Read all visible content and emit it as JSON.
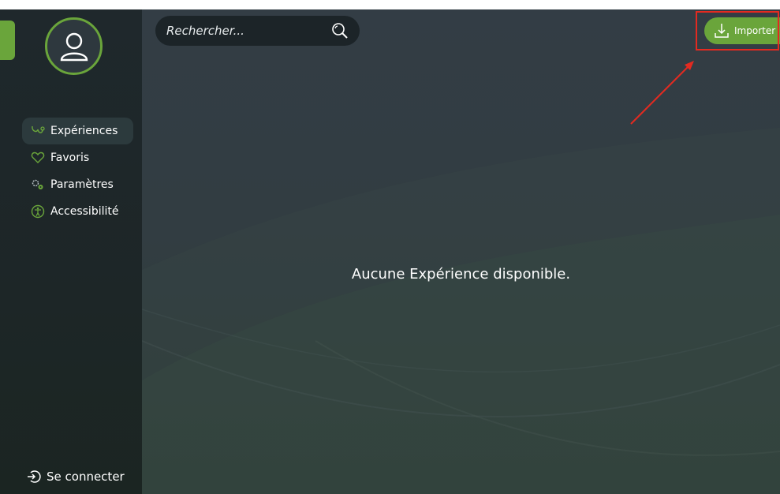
{
  "sidebar": {
    "items": [
      {
        "label": "Expériences",
        "icon": "stethoscope-icon",
        "active": true
      },
      {
        "label": "Favoris",
        "icon": "heart-icon",
        "active": false
      },
      {
        "label": "Paramètres",
        "icon": "gears-icon",
        "active": false
      },
      {
        "label": "Accessibilité",
        "icon": "accessibility-icon",
        "active": false
      }
    ],
    "login_label": "Se connecter"
  },
  "search": {
    "placeholder": "Rechercher..."
  },
  "toolbar": {
    "import_label": "Importer"
  },
  "main": {
    "empty_message": "Aucune Expérience disponible."
  },
  "colors": {
    "accent": "#6aa53b",
    "background": "#333d45",
    "sidebar": "#1f282c",
    "annotation": "#e42a20"
  }
}
